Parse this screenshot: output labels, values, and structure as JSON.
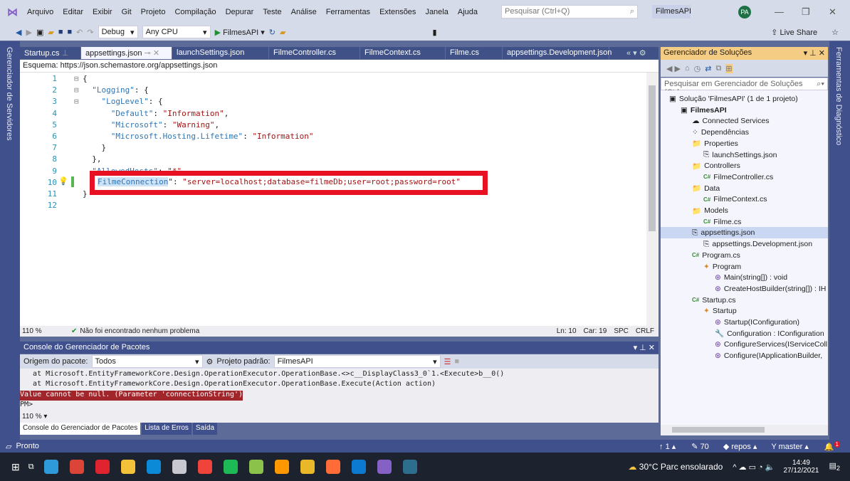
{
  "menu": [
    "Arquivo",
    "Editar",
    "Exibir",
    "Git",
    "Projeto",
    "Compilação",
    "Depurar",
    "Teste",
    "Análise",
    "Ferramentas",
    "Extensões",
    "Janela",
    "Ajuda"
  ],
  "search_placeholder": "Pesquisar (Ctrl+Q)",
  "project_name": "FilmesAPI",
  "avatar": "PA",
  "toolbar": {
    "config": "Debug",
    "platform": "Any CPU",
    "run": "FilmesAPI",
    "live_share": "Live Share"
  },
  "left_strip": "Gerenciador de Servidores",
  "right_strip": "Ferramentas de Diagnóstico",
  "tabs": [
    "Startup.cs",
    "appsettings.json",
    "launchSettings.json",
    "FilmeController.cs",
    "FilmeContext.cs",
    "Filme.cs",
    "appsettings.Development.json"
  ],
  "schema": {
    "label": "Esquema:",
    "value": "https://json.schemastore.org/appsettings.json"
  },
  "code_lines": [
    {
      "n": "1",
      "parts": [
        [
          "p",
          "{"
        ]
      ]
    },
    {
      "n": "2",
      "parts": [
        [
          "p",
          "  "
        ],
        [
          "k",
          "\"Logging\""
        ],
        [
          "p",
          ": {"
        ]
      ]
    },
    {
      "n": "3",
      "parts": [
        [
          "p",
          "    "
        ],
        [
          "k",
          "\"LogLevel\""
        ],
        [
          "p",
          ": {"
        ]
      ]
    },
    {
      "n": "4",
      "parts": [
        [
          "p",
          "      "
        ],
        [
          "k",
          "\"Default\""
        ],
        [
          "p",
          ": "
        ],
        [
          "s",
          "\"Information\""
        ],
        [
          "p",
          ","
        ]
      ]
    },
    {
      "n": "5",
      "parts": [
        [
          "p",
          "      "
        ],
        [
          "k",
          "\"Microsoft\""
        ],
        [
          "p",
          ": "
        ],
        [
          "s",
          "\"Warning\""
        ],
        [
          "p",
          ","
        ]
      ]
    },
    {
      "n": "6",
      "parts": [
        [
          "p",
          "      "
        ],
        [
          "k",
          "\"Microsoft.Hosting.Lifetime\""
        ],
        [
          "p",
          ": "
        ],
        [
          "s",
          "\"Information\""
        ]
      ]
    },
    {
      "n": "7",
      "parts": [
        [
          "p",
          "    }"
        ]
      ]
    },
    {
      "n": "8",
      "parts": [
        [
          "p",
          "  },"
        ]
      ]
    },
    {
      "n": "9",
      "parts": [
        [
          "k",
          "  \"AllowedHosts\""
        ],
        [
          "p",
          ": "
        ],
        [
          "s",
          "\"*\""
        ]
      ]
    },
    {
      "n": "10",
      "parts": []
    },
    {
      "n": "11",
      "parts": [
        [
          "p",
          "}"
        ]
      ]
    },
    {
      "n": "12",
      "parts": []
    }
  ],
  "highlighted_line": {
    "key": "FilmeConnection",
    "sep": "\": ",
    "value": "\"server=localhost;database=filmeDb;user=root;password=root\""
  },
  "editor_status": {
    "zoom": "110 %",
    "problems": "Não foi encontrado nenhum problema",
    "ln": "Ln: 10",
    "car": "Car: 19",
    "spc": "SPC",
    "crlf": "CRLF"
  },
  "pmc": {
    "title": "Console do Gerenciador de Pacotes",
    "source_label": "Origem do pacote:",
    "source": "Todos",
    "project_label": "Projeto padrão:",
    "project": "FilmesAPI",
    "lines": [
      "   at Microsoft.EntityFrameworkCore.Design.OperationExecutor.OperationBase.<>c__DisplayClass3_0`1.<Execute>b__0()",
      "   at Microsoft.EntityFrameworkCore.Design.OperationExecutor.OperationBase.Execute(Action action)"
    ],
    "error": "Value cannot be null. (Parameter 'connectionString')",
    "prompt": "PM>",
    "zoom": "110 %"
  },
  "bottom_tabs": [
    "Console do Gerenciador de Pacotes",
    "Lista de Erros",
    "Saída"
  ],
  "solution_explorer": {
    "title": "Gerenciador de Soluções",
    "search": "Pesquisar em Gerenciador de Soluções (Ctrl",
    "items": [
      {
        "label": "Solução 'FilmesAPI' (1 de 1 projeto)",
        "indent": 0,
        "icon": "solution-icon"
      },
      {
        "label": "FilmesAPI",
        "indent": 1,
        "icon": "project-icon",
        "bold": true
      },
      {
        "label": "Connected Services",
        "indent": 2,
        "icon": "connected-services-icon"
      },
      {
        "label": "Dependências",
        "indent": 2,
        "icon": "dependencies-icon"
      },
      {
        "label": "Properties",
        "indent": 2,
        "icon": "folder-icon"
      },
      {
        "label": "launchSettings.json",
        "indent": 3,
        "icon": "json-icon"
      },
      {
        "label": "Controllers",
        "indent": 2,
        "icon": "folder-icon"
      },
      {
        "label": "FilmeController.cs",
        "indent": 3,
        "icon": "csharp-icon"
      },
      {
        "label": "Data",
        "indent": 2,
        "icon": "folder-icon"
      },
      {
        "label": "FilmeContext.cs",
        "indent": 3,
        "icon": "csharp-icon"
      },
      {
        "label": "Models",
        "indent": 2,
        "icon": "folder-icon"
      },
      {
        "label": "Filme.cs",
        "indent": 3,
        "icon": "csharp-icon"
      },
      {
        "label": "appsettings.json",
        "indent": 2,
        "icon": "json-icon",
        "selected": true
      },
      {
        "label": "appsettings.Development.json",
        "indent": 3,
        "icon": "json-icon"
      },
      {
        "label": "Program.cs",
        "indent": 2,
        "icon": "csharp-icon"
      },
      {
        "label": "Program",
        "indent": 3,
        "icon": "class-icon"
      },
      {
        "label": "Main(string[]) : void",
        "indent": 4,
        "icon": "method-icon"
      },
      {
        "label": "CreateHostBuilder(string[]) : IH",
        "indent": 4,
        "icon": "method-icon"
      },
      {
        "label": "Startup.cs",
        "indent": 2,
        "icon": "csharp-icon"
      },
      {
        "label": "Startup",
        "indent": 3,
        "icon": "class-icon"
      },
      {
        "label": "Startup(IConfiguration)",
        "indent": 4,
        "icon": "method-icon"
      },
      {
        "label": "Configuration : IConfiguration",
        "indent": 4,
        "icon": "property-icon"
      },
      {
        "label": "ConfigureServices(IServiceColl",
        "indent": 4,
        "icon": "method-icon"
      },
      {
        "label": "Configure(IApplicationBuilder,",
        "indent": 4,
        "icon": "method-icon"
      }
    ]
  },
  "statusbar": {
    "ready": "Pronto",
    "up": "1",
    "edits": "70",
    "repo": "repos",
    "branch": "master",
    "notifications": "1"
  },
  "taskbar": {
    "weather": "30°C  Parc ensolarado",
    "time": "14:49",
    "date": "27/12/2021",
    "notif": "2",
    "apps": [
      {
        "name": "edge",
        "color": "#2f9ad9"
      },
      {
        "name": "chrome",
        "color": "#db4437"
      },
      {
        "name": "opera",
        "color": "#e0242f"
      },
      {
        "name": "file-explorer",
        "color": "#f3c13a"
      },
      {
        "name": "skype",
        "color": "#0b8ad8"
      },
      {
        "name": "paint",
        "color": "#c8c8d0"
      },
      {
        "name": "anydesk",
        "color": "#ef443b"
      },
      {
        "name": "spotify",
        "color": "#1db954"
      },
      {
        "name": "notepad",
        "color": "#8bc34a"
      },
      {
        "name": "sublime",
        "color": "#ff9800"
      },
      {
        "name": "git-tool",
        "color": "#e8b829"
      },
      {
        "name": "postman",
        "color": "#ff6c37"
      },
      {
        "name": "vscode",
        "color": "#0d7ad1"
      },
      {
        "name": "visual-studio",
        "color": "#8661c5"
      },
      {
        "name": "mysql-workbench",
        "color": "#2d6e8e"
      }
    ]
  },
  "colors": {
    "vs_blue": "#40508d",
    "highlight_box": "#e81123",
    "error_bg": "#a1262b"
  }
}
